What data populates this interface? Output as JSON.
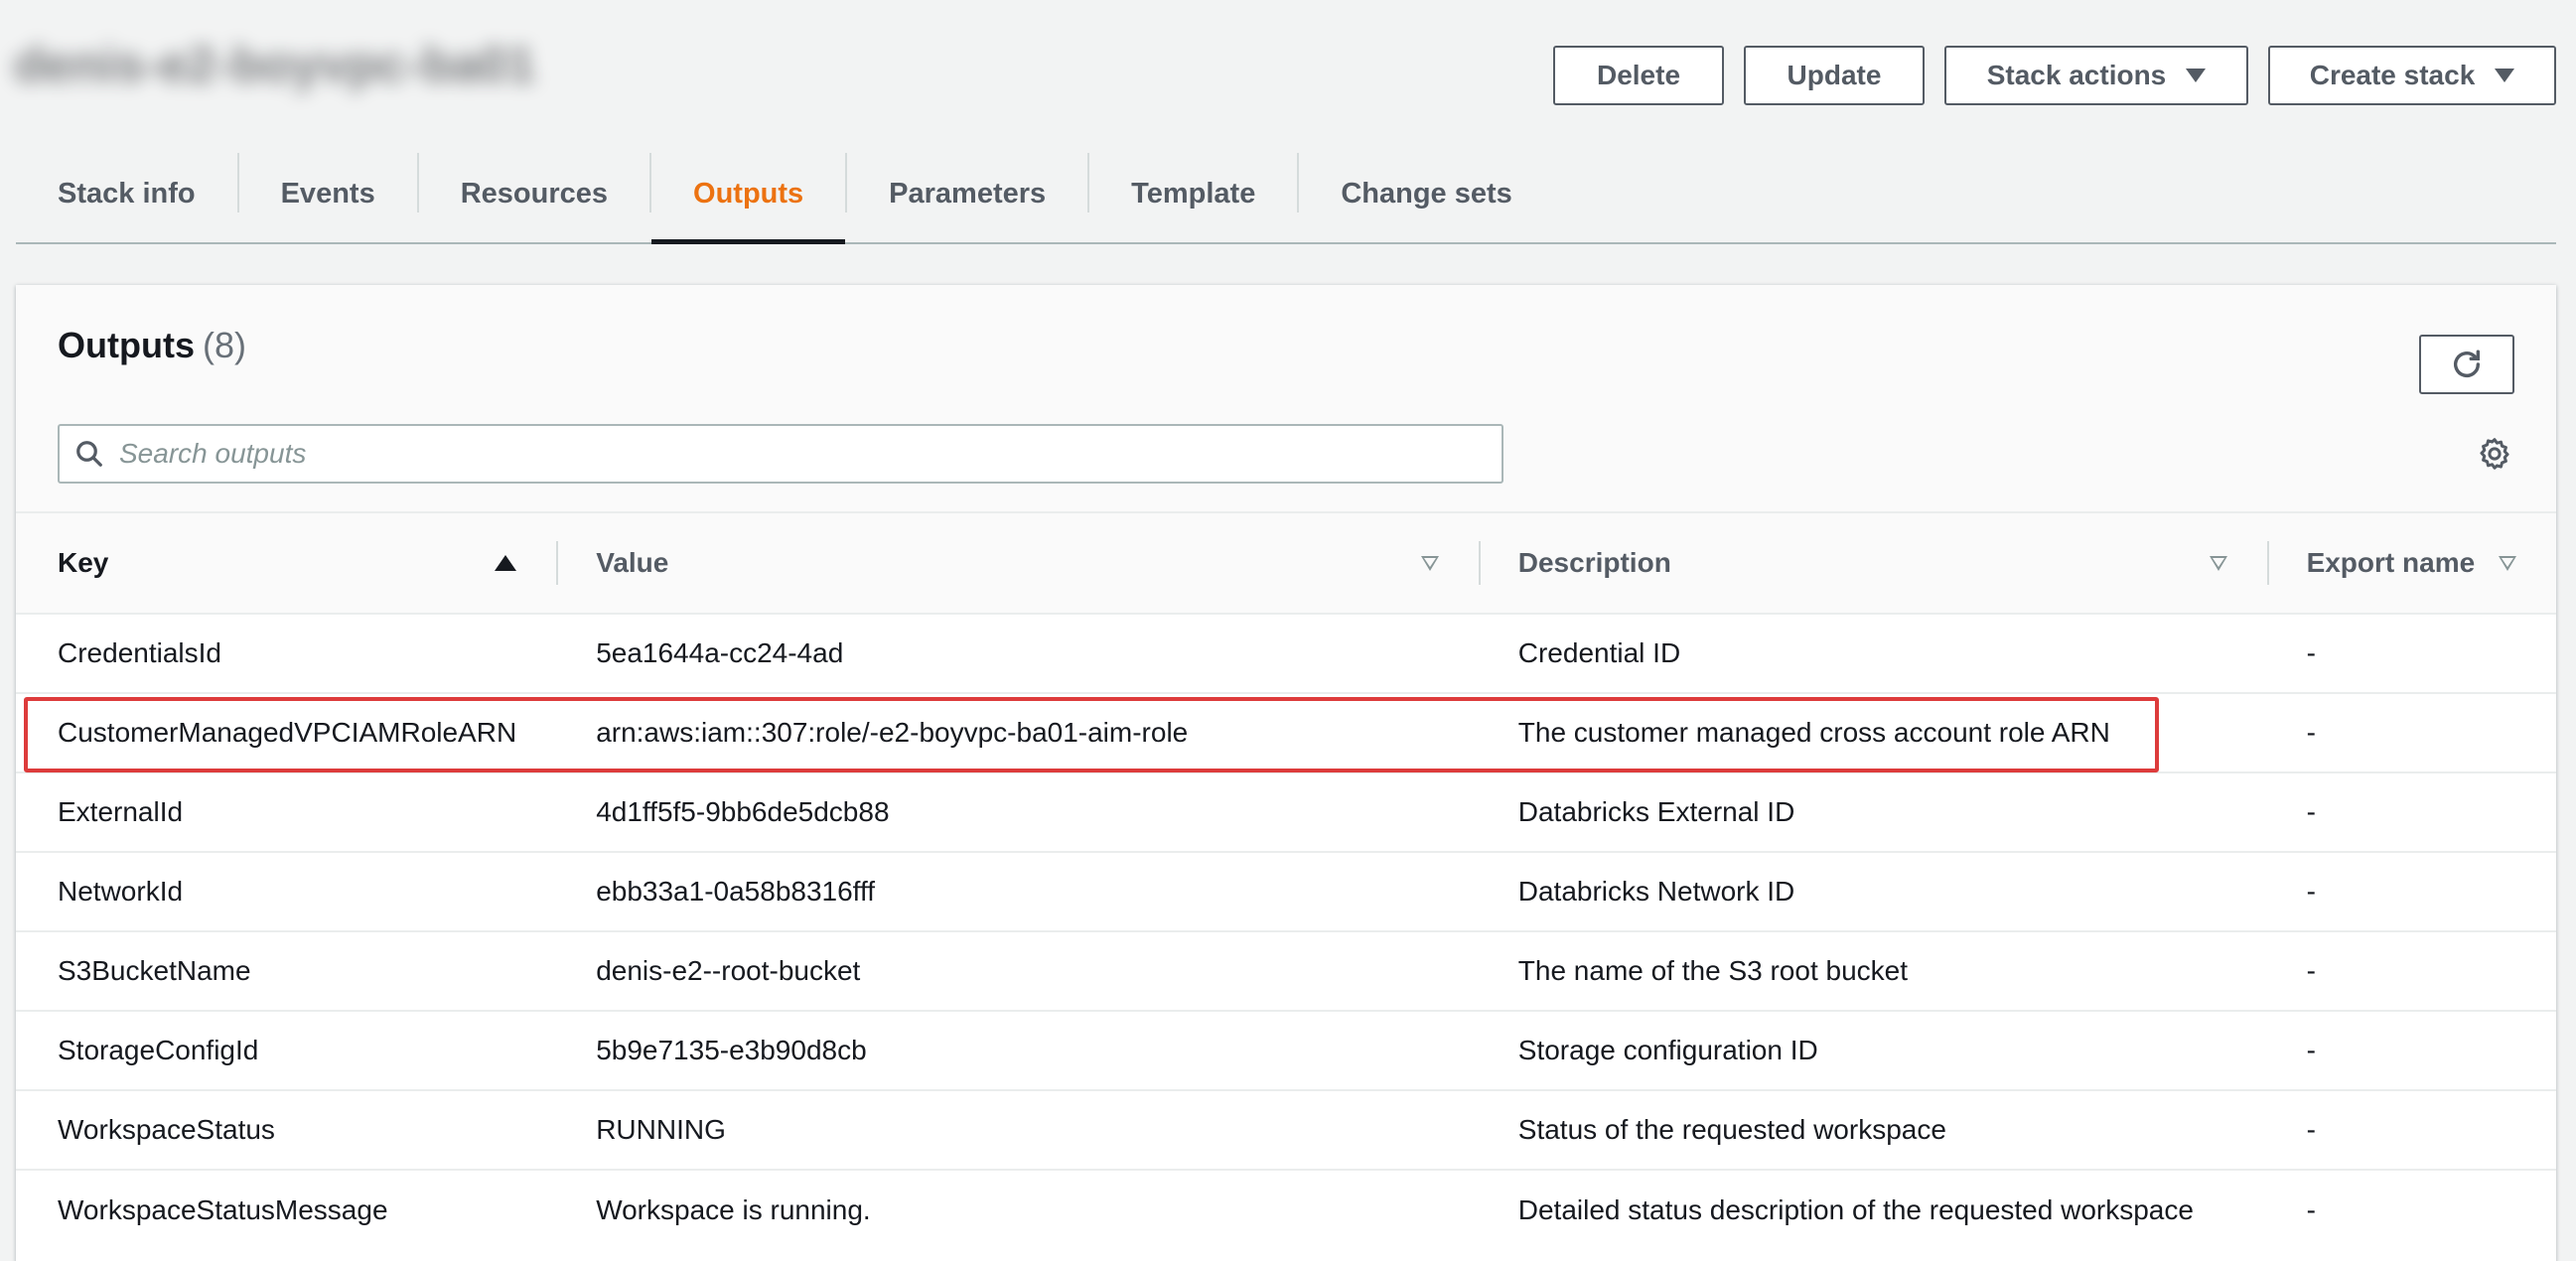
{
  "stack": {
    "name": "denis-e2-boyvpc-ba01"
  },
  "header_buttons": {
    "delete": "Delete",
    "update": "Update",
    "stack_actions": "Stack actions",
    "create_stack": "Create stack"
  },
  "tabs": [
    {
      "label": "Stack info",
      "active": false
    },
    {
      "label": "Events",
      "active": false
    },
    {
      "label": "Resources",
      "active": false
    },
    {
      "label": "Outputs",
      "active": true
    },
    {
      "label": "Parameters",
      "active": false
    },
    {
      "label": "Template",
      "active": false
    },
    {
      "label": "Change sets",
      "active": false
    }
  ],
  "outputs": {
    "title": "Outputs",
    "count": "(8)",
    "search_placeholder": "Search outputs",
    "columns": {
      "key": "Key",
      "value": "Value",
      "description": "Description",
      "export_name": "Export name"
    },
    "rows": [
      {
        "key": "CredentialsId",
        "value_a": "5ea1644a-cc24-4ad",
        "value_blur": "",
        "value_b": "",
        "description": "Credential ID",
        "export": "-"
      },
      {
        "key": "CustomerManagedVPCIAMRoleARN",
        "value_a": "arn:aws:iam::",
        "value_blur": "",
        "value_b": "307:role/",
        "value_blur2": "",
        "value_c": "-e2-boyvpc-ba01-aim-role",
        "description": "The customer managed cross account role ARN",
        "export": "-"
      },
      {
        "key": "ExternalId",
        "value_a": "4d1ff5f5-",
        "value_blur": "",
        "value_b": "9bb6de5dcb88",
        "description": "Databricks External ID",
        "export": "-"
      },
      {
        "key": "NetworkId",
        "value_a": "ebb33a1",
        "value_blur": "",
        "value_b": "-0a58b8316fff",
        "description": "Databricks Network ID",
        "export": "-"
      },
      {
        "key": "S3BucketName",
        "value_a": "denis-e2-",
        "value_blur": "",
        "value_b": "-root-bucket",
        "description": "The name of the S3 root bucket",
        "export": "-"
      },
      {
        "key": "StorageConfigId",
        "value_a": "5b9e7135-",
        "value_blur": "",
        "value_b": "e3b90d8cb",
        "description": "Storage configuration ID",
        "export": "-"
      },
      {
        "key": "WorkspaceStatus",
        "value_a": "RUNNING",
        "value_blur": "",
        "value_b": "",
        "description": "Status of the requested workspace",
        "export": "-"
      },
      {
        "key": "WorkspaceStatusMessage",
        "value_a": "Workspace is running.",
        "value_blur": "",
        "value_b": "",
        "description": "Detailed status description of the requested workspace",
        "export": "-"
      }
    ]
  },
  "colors": {
    "accent": "#ec7211",
    "highlight": "#dd3b3b",
    "text": "#16191f",
    "muted": "#545b64"
  },
  "icons": {
    "search": "search-icon",
    "refresh": "refresh-icon",
    "settings": "gear-icon",
    "caret": "caret-down-icon",
    "sort": "sort-icon"
  }
}
